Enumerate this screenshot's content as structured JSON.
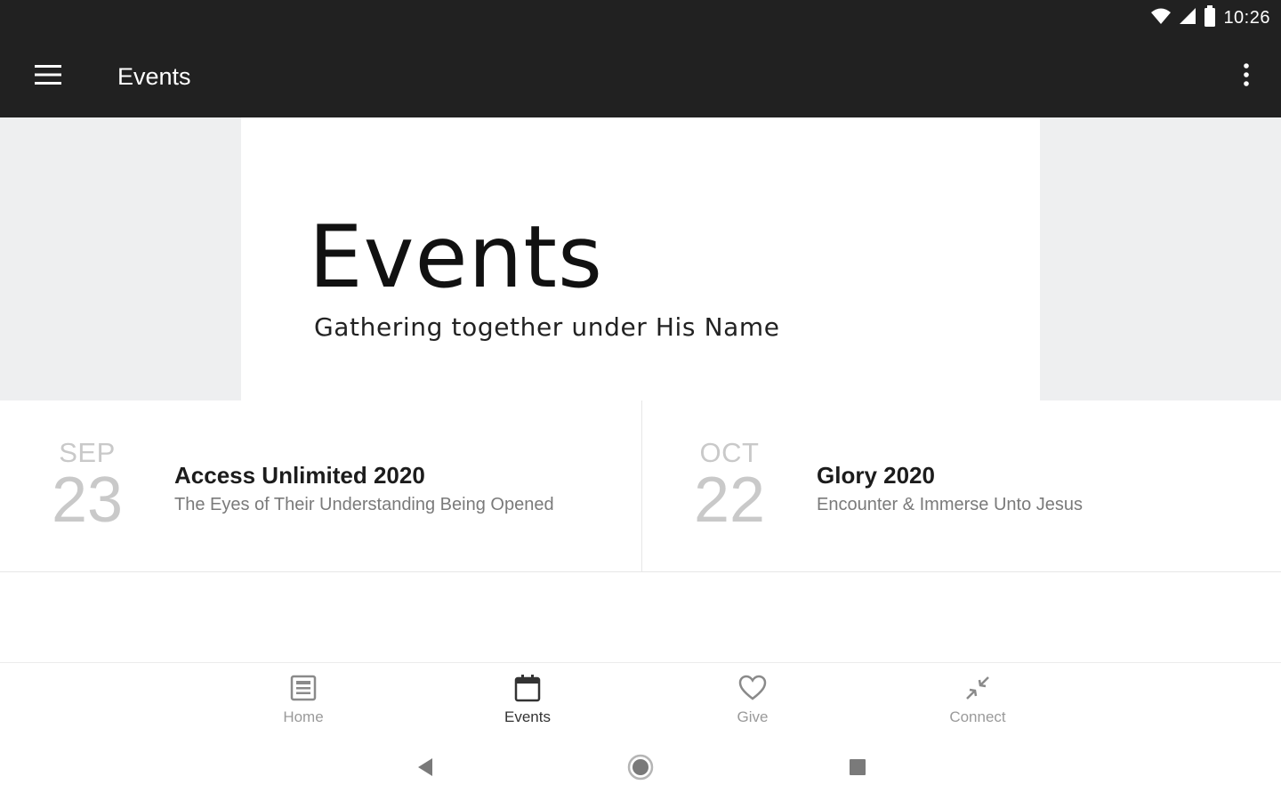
{
  "status_bar": {
    "time": "10:26",
    "icons": [
      "wifi-icon",
      "signal-icon",
      "battery-icon"
    ]
  },
  "app_bar": {
    "title": "Events",
    "menu_icon": "hamburger-menu-icon",
    "overflow_icon": "more-vert-icon"
  },
  "hero": {
    "title": "Events",
    "subtitle": "Gathering together under His Name"
  },
  "events": [
    {
      "month": "SEP",
      "day": "23",
      "title": "Access Unlimited 2020",
      "description": "The Eyes of Their Understanding Being Opened"
    },
    {
      "month": "OCT",
      "day": "22",
      "title": "Glory 2020",
      "description": "Encounter & Immerse Unto Jesus"
    }
  ],
  "bottom_nav": [
    {
      "label": "Home",
      "icon": "home-news-icon",
      "active": false
    },
    {
      "label": "Events",
      "icon": "calendar-icon",
      "active": true
    },
    {
      "label": "Give",
      "icon": "heart-icon",
      "active": false
    },
    {
      "label": "Connect",
      "icon": "connect-arrows-icon",
      "active": false
    }
  ],
  "system_nav": [
    "back-icon",
    "home-circle-icon",
    "recents-square-icon"
  ],
  "colors": {
    "app_bar": "#212121",
    "hero_background": "#eeeff0",
    "date_text": "#c9c9c9",
    "nav_active": "#333333",
    "nav_inactive": "#9a9a9a"
  }
}
